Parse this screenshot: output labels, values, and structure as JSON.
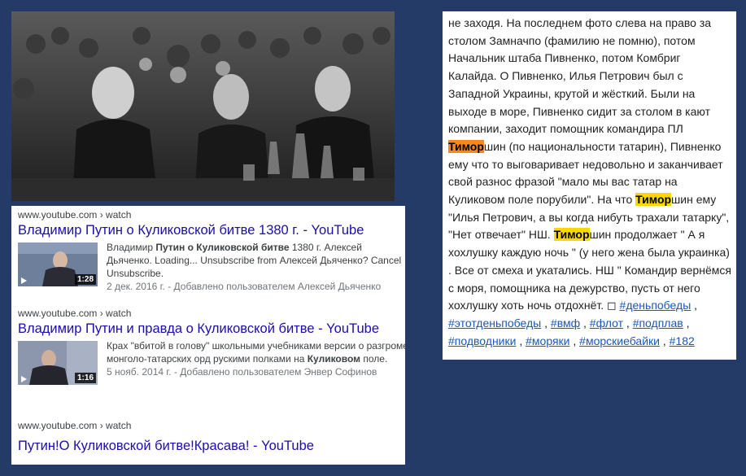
{
  "photo": {},
  "results": [
    {
      "url": "www.youtube.com › watch",
      "title": "Владимир Путин о Куликовской битве 1380 г. - YouTube",
      "duration": "1:28",
      "snippet_pre": "Владимир ",
      "snippet_bold": "Путин о Куликовской битве",
      "snippet_post": " 1380 г. Алексей Дьяченко. Loading... Unsubscribe from Алексей Дьяченко? Cancel Unsubscribe.",
      "date": "2 дек. 2016 г. - Добавлено пользователем Алексей Дьяченко"
    },
    {
      "url": "www.youtube.com › watch",
      "title": "Владимир Путин и правда о Куликовской битве - YouTube",
      "duration": "1:16",
      "snippet_pre": "Крах \"вбитой в голову\" школьными учебниками версии о разгроме монголо-татарских орд рускими полками на ",
      "snippet_bold": "Куликовом",
      "snippet_post": " поле.",
      "date": "5 нояб. 2014 г. - Добавлено пользователем Энвер Софинов"
    },
    {
      "url": "www.youtube.com › watch",
      "title": "Путин!О Куликовской битве!Красава! - YouTube"
    }
  ],
  "story": {
    "p1": "не заходя. На последнем фото слева на право за столом Замначпо (фамилию не помню), потом Начальник штаба Пивненко, потом Комбриг Калайда. О Пивненко, Илья Петрович был с Западной Украины, крутой и жёсткий. Были на выходе в море, Пивненко сидит за столом в кают компании, заходит помощник командира ПЛ ",
    "hl1": "Тимор",
    "p2": "шин (по национальности татарин), Пивненко ему что то выговаривает недовольно и заканчивает свой разнос фразой \"мало мы вас татар на Куликовом поле порубили\". На что ",
    "hl2": "Тимор",
    "p3": "шин ему \"Илья Петрович, а вы когда нибуть трахали татарку\", \"Нет отвечает\" НШ. ",
    "hl3": "Тимор",
    "p4": "шин продолжает \" А я хохлушку каждую ночь \" (у него жена была украинка) . Все от смеха и укатались. НШ \" Командир вернёмся с моря, помощника на дежурство, пусть от него хохлушку хоть ночь отдохнёт. ",
    "glyph": "◻",
    "tags": [
      "#деньпобеды",
      "#этотденьпобеды",
      "#вмф",
      "#флот",
      "#подплав",
      "#подводники",
      "#моряки",
      "#морскиебайки",
      "#182"
    ]
  }
}
